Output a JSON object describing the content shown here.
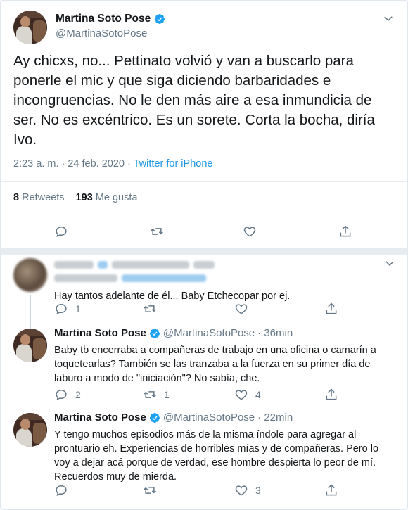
{
  "main_tweet": {
    "display_name": "Martina Soto Pose",
    "handle": "@MartinaSotoPose",
    "text": "Ay chicxs, no... Pettinato volvió y van a buscarlo para ponerle el mic y que siga diciendo barbaridades e incongruencias. No le den más aire a esa inmundicia de ser. No es excéntrico. Es un sorete. Corta la bocha, diría Ivo.",
    "timestamp": "2:23 a. m. · 24 feb. 2020 · ",
    "source": "Twitter for iPhone",
    "retweets_count": "8",
    "retweets_label": "Retweets",
    "likes_count": "193",
    "likes_label": "Me gusta"
  },
  "replies": [
    {
      "text": "Hay tantos adelante de él... Baby Etchecopar por ej.",
      "reply_count": "1",
      "retweet_count": "",
      "like_count": ""
    },
    {
      "display_name": "Martina Soto Pose",
      "handle": "@MartinaSotoPose",
      "time": "· 36min",
      "text": "Baby tb encerraba a compañeras de trabajo en una oficina o camarín a toquetearlas? También se las tranzaba a la fuerza en su primer día de laburo a modo de \"iniciación\"? No sabía, che.",
      "reply_count": "2",
      "retweet_count": "1",
      "like_count": "4"
    },
    {
      "display_name": "Martina Soto Pose",
      "handle": "@MartinaSotoPose",
      "time": "· 22min",
      "text": "Y tengo muchos episodios más de la misma índole para agregar al prontuario eh. Experiencias de horribles mías y de compañeras. Pero lo voy a dejar acá porque de verdad, ese hombre despierta lo peor de mí. Recuerdos muy de mierda.",
      "reply_count": "",
      "retweet_count": "",
      "like_count": "3"
    }
  ],
  "colors": {
    "accent": "#1da1f2",
    "link": "#1b95e0",
    "muted": "#657786",
    "text": "#14171a",
    "border": "#e6ecf0"
  }
}
